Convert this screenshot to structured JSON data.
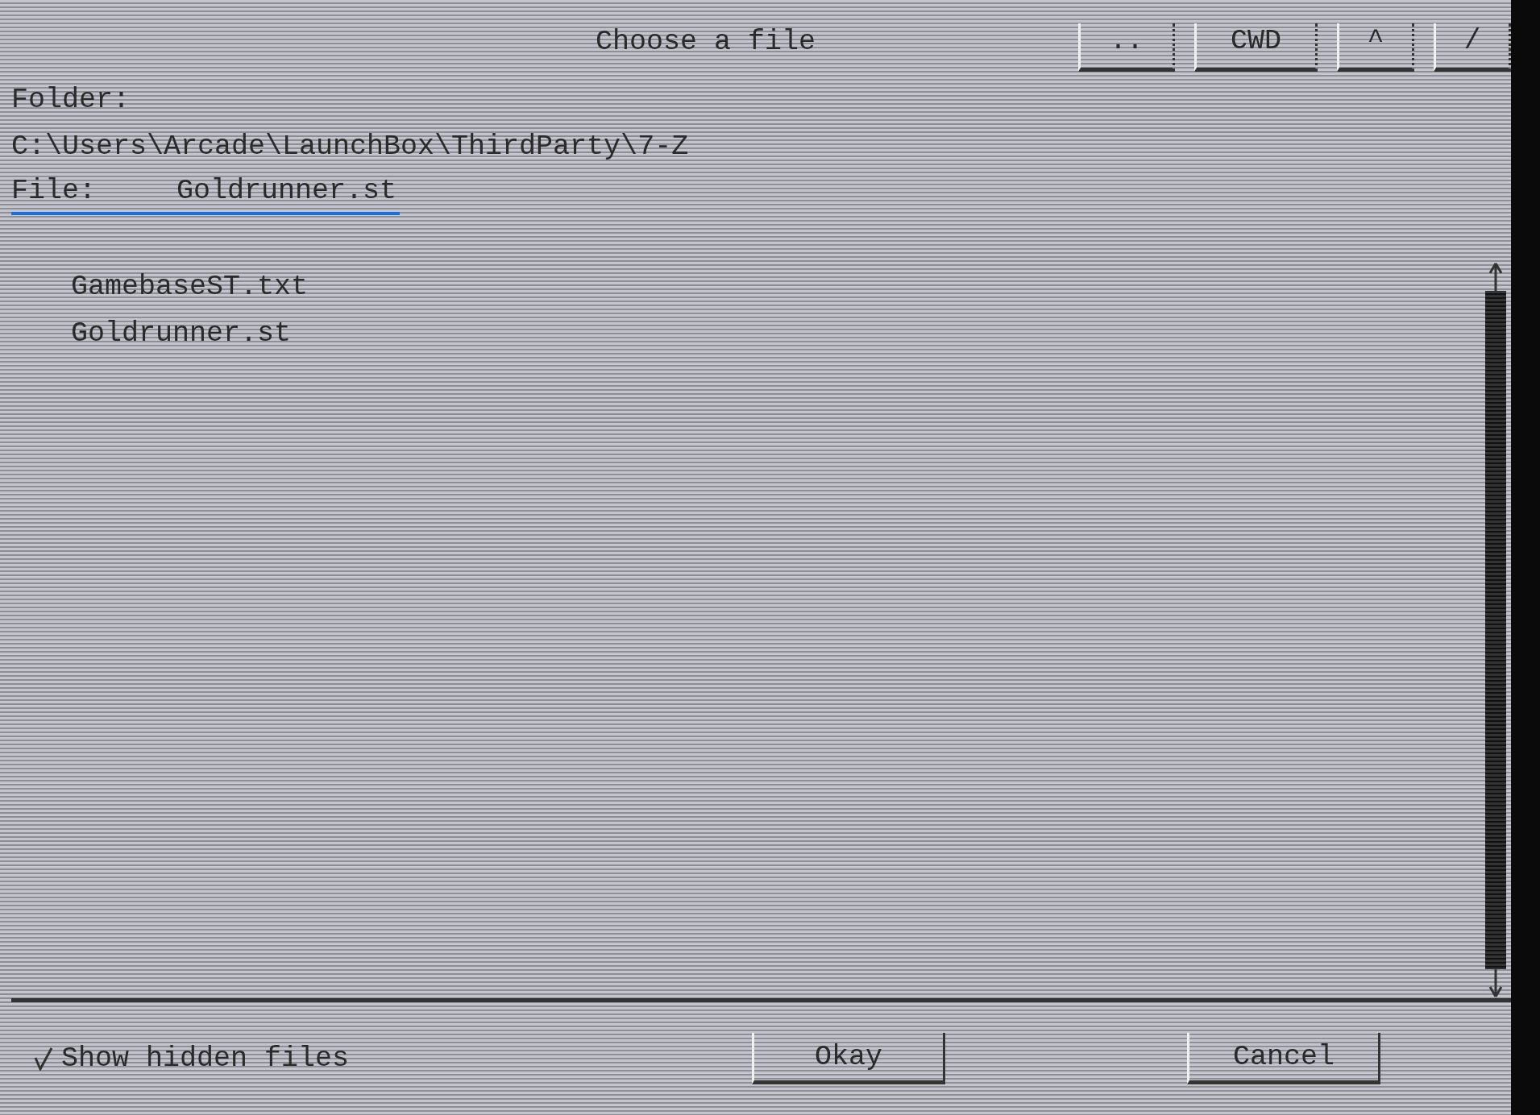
{
  "title": "Choose a file",
  "nav_buttons": [
    {
      "label": ".."
    },
    {
      "label": "CWD"
    },
    {
      "label": "^"
    },
    {
      "label": "/"
    }
  ],
  "folder_label": "Folder:",
  "folder_path": "C:\\Users\\Arcade\\LaunchBox\\ThirdParty\\7-Z",
  "file_label": "File:",
  "file_value": "Goldrunner.st",
  "files": [
    {
      "name": "GamebaseST.txt",
      "selected": false
    },
    {
      "name": "Goldrunner.st",
      "selected": false
    }
  ],
  "show_hidden": {
    "label": "Show hidden files",
    "checked": true
  },
  "buttons": [
    {
      "label": "Okay"
    },
    {
      "label": "Cancel"
    }
  ]
}
